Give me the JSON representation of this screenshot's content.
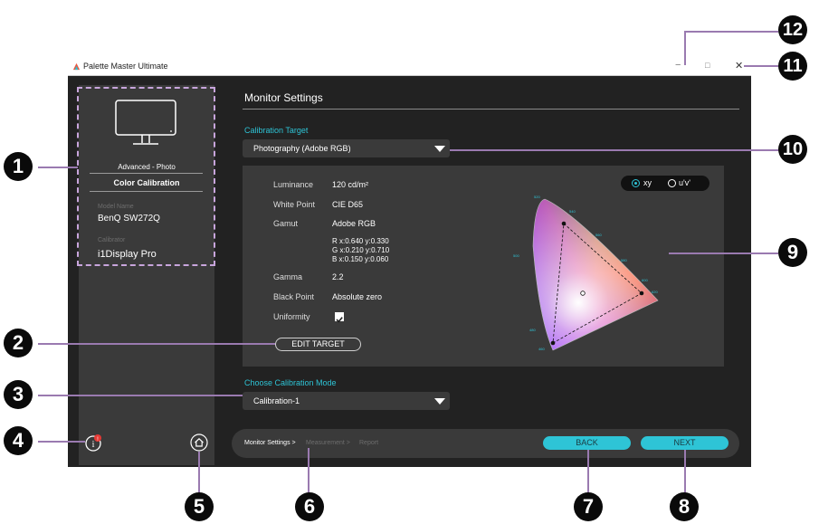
{
  "window": {
    "app_title": "Palette Master Ultimate",
    "minimize_glyph": "−",
    "maximize_glyph": "□",
    "close_glyph": "✕"
  },
  "sidebar": {
    "mode_label": "Advanced - Photo",
    "section_label": "Color Calibration",
    "model_name_label": "Model Name",
    "model_name_value": "BenQ SW272Q",
    "calibrator_label": "Calibrator",
    "calibrator_value": "i1Display Pro",
    "info_icon": "info-icon",
    "home_icon": "home-icon"
  },
  "main": {
    "page_title": "Monitor Settings",
    "calibration_target_label": "Calibration Target",
    "calibration_target_value": "Photography (Adobe RGB)",
    "target": {
      "luminance_label": "Luminance",
      "luminance_value": "120 cd/m²",
      "white_point_label": "White Point",
      "white_point_value": "CIE D65",
      "gamut_label": "Gamut",
      "gamut_value": "Adobe RGB",
      "r_value": "R x:0.640 y:0.330",
      "g_value": "G x:0.210 y:0.710",
      "b_value": "B x:0.150 y:0.060",
      "gamma_label": "Gamma",
      "gamma_value": "2.2",
      "black_point_label": "Black Point",
      "black_point_value": "Absolute zero",
      "uniformity_label": "Uniformity",
      "uniformity_checked": true
    },
    "chart_toggle": {
      "option_xy": "xy",
      "option_uv": "u'v'",
      "selected": "xy"
    },
    "chart_wavelength_labels": [
      "520",
      "540",
      "560",
      "580",
      "600",
      "620",
      "500",
      "480",
      "460"
    ],
    "edit_target_label": "EDIT TARGET",
    "calibration_mode_label": "Choose Calibration Mode",
    "calibration_mode_value": "Calibration-1"
  },
  "footer": {
    "step1": "Monitor Settings >",
    "step2": "Measurement >",
    "step3": "Report",
    "back_label": "BACK",
    "next_label": "NEXT"
  },
  "callouts": [
    "1",
    "2",
    "3",
    "4",
    "5",
    "6",
    "7",
    "8",
    "9",
    "10",
    "11",
    "12"
  ],
  "colors": {
    "accent": "#2ec4d6",
    "window_bg": "#222222",
    "panel_bg": "#3a3a3a",
    "dashed_outline": "#c8a5dc"
  }
}
